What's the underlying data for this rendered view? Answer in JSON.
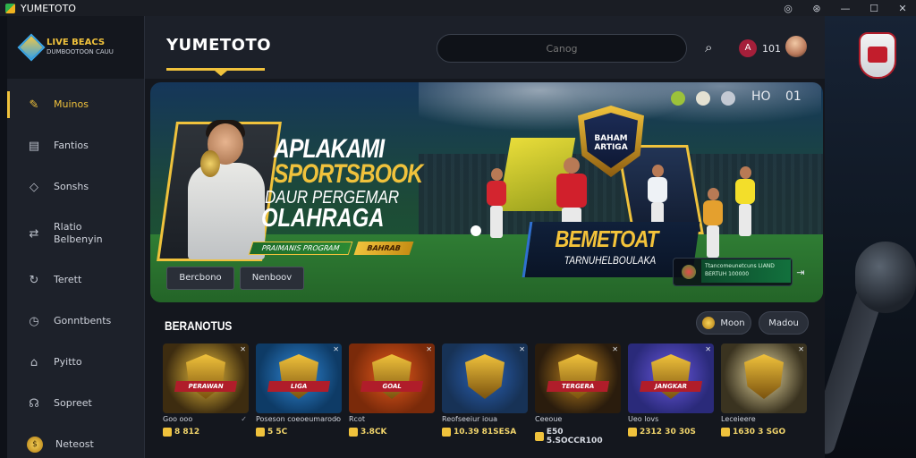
{
  "window": {
    "app_name": "YUMETOTO",
    "controls": [
      "◎",
      "⊛",
      "—",
      "☐",
      "✕"
    ]
  },
  "sidebar": {
    "brand_line1": "LIVE BEACS",
    "brand_line2": "DUMBOOTOON CAUU",
    "items": [
      {
        "label": "Muinos",
        "icon": "pen-icon"
      },
      {
        "label": "Fantios",
        "icon": "document-icon"
      },
      {
        "label": "Sonshs",
        "icon": "tag-icon"
      },
      {
        "label": "Rlatio Belbenyin",
        "icon": "shuffle-icon"
      },
      {
        "label": "Terett",
        "icon": "refresh-icon"
      },
      {
        "label": "Gonntbents",
        "icon": "clock-icon"
      },
      {
        "label": "Pyitto",
        "icon": "home-icon"
      },
      {
        "label": "Sopreet",
        "icon": "headset-icon"
      },
      {
        "label": "Neteost",
        "icon": "coin-icon"
      }
    ]
  },
  "header": {
    "title": "YUMETOTO",
    "search_placeholder": "Canog",
    "notif_icon_text": "A",
    "notif_count": "101"
  },
  "banner": {
    "line1": "APLAKAMI",
    "line2": "SPORTSBOOK",
    "line3": "DAUR PERGEMAR",
    "line4": "OLAHRAGA",
    "tag1": "PRAIMANIS PROGRAM",
    "tag2": "BAHRAB",
    "button1": "Bercbono",
    "button2": "Nenboov",
    "shield_text": "BAHAM ARTIGA",
    "promo_title": "BEMETOAT",
    "promo_sub": "TARNUHELBOULAKA",
    "odds_text": "Ttancomeunetcuns LIAND BERTUH 100000",
    "hud_left": "HO",
    "hud_right": "01"
  },
  "section": {
    "title": "BERANOTUS",
    "more_label": "Moon",
    "next_label": "Madou"
  },
  "games": [
    {
      "name": "Goo ooo",
      "price": "8 812",
      "price_grey": false,
      "emblem": "PERAWAN",
      "mark": "✓",
      "bg": "#3d2c10",
      "tone": "#f0c23c"
    },
    {
      "name": "Poseson coeoeumarodo",
      "price": "5 5C",
      "price_grey": false,
      "emblem": "LIGA",
      "mark": "✓",
      "bg": "#0e3b66",
      "tone": "#2f88d8"
    },
    {
      "name": "Rcot",
      "price": "3.8CK",
      "price_grey": false,
      "emblem": "GOAL",
      "mark": "",
      "bg": "#7a2a0a",
      "tone": "#e85a1c"
    },
    {
      "name": "Reofseeiur ioua",
      "price": "10.39 81SESA",
      "price_grey": false,
      "emblem": "",
      "mark": "",
      "bg": "#173256",
      "tone": "#2a62b8"
    },
    {
      "name": "Ceeoue",
      "price": "E50 5.SOCCR100",
      "price_grey": true,
      "emblem": "TERGERA",
      "mark": "",
      "bg": "#2a1c0d",
      "tone": "#c2841e"
    },
    {
      "name": "Ueo lovs",
      "price": "2312 30 30S",
      "price_grey": false,
      "emblem": "JANGKAR",
      "mark": "",
      "bg": "#2a2a7a",
      "tone": "#6a58e0"
    },
    {
      "name": "Leceieere",
      "price": "1630 3 SGO",
      "price_grey": false,
      "emblem": "",
      "mark": "",
      "bg": "#3a3320",
      "tone": "#e8d9a0"
    }
  ]
}
